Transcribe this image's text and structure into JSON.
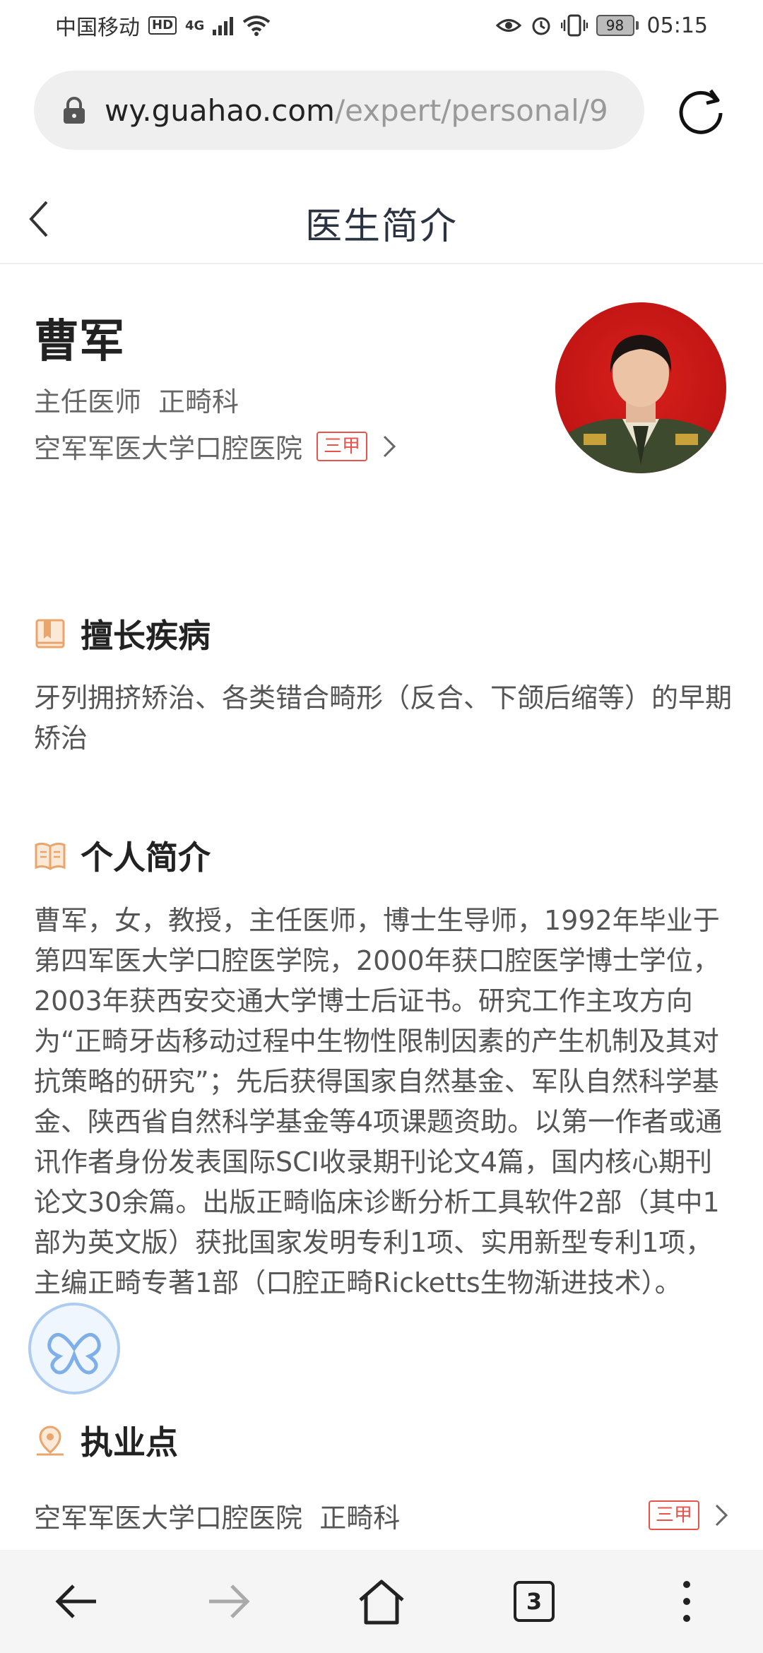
{
  "status_bar": {
    "carrier": "中国移动",
    "hd": "HD",
    "signal": "4G",
    "battery": "98",
    "time": "05:15"
  },
  "address_bar": {
    "host": "wy.guahao.com",
    "path": "/expert/personal/9"
  },
  "title_bar": {
    "title": "医生简介"
  },
  "doctor": {
    "name": "曹军",
    "position": "主任医师",
    "department": "正畸科",
    "hospital": "空军军医大学口腔医院",
    "grade": "三甲"
  },
  "specialty": {
    "heading": "擅长疾病",
    "text": "牙列拥挤矫治、各类错合畸形（反合、下颌后缩等）的早期矫治"
  },
  "profile": {
    "heading": "个人简介",
    "text": "  曹军，女，教授，主任医师，博士生导师，1992年毕业于第四军医大学口腔医学院，2000年获口腔医学博士学位，2003年获西安交通大学博士后证书。研究工作主攻方向为“正畸牙齿移动过程中生物性限制因素的产生机制及其对抗策略的研究”；先后获得国家自然基金、军队自然科学基金、陕西省自然科学基金等4项课题资助。以第一作者或通讯作者身份发表国际SCI收录期刊论文4篇，国内核心期刊论文30余篇。出版正畸临床诊断分析工具软件2部（其中1部为英文版）获批国家发明专利1项、实用新型专利1项，主编正畸专著1部（口腔正畸Ricketts生物渐进技术）。"
  },
  "practice": {
    "heading": "执业点",
    "hospital": "空军军医大学口腔医院",
    "department": "正畸科",
    "grade": "三甲"
  },
  "bottom_nav": {
    "tab_count": "3"
  },
  "colors": {
    "accent_red": "#e8534a",
    "icon_orange": "#e9a56b",
    "title_text": "#2b3340"
  }
}
